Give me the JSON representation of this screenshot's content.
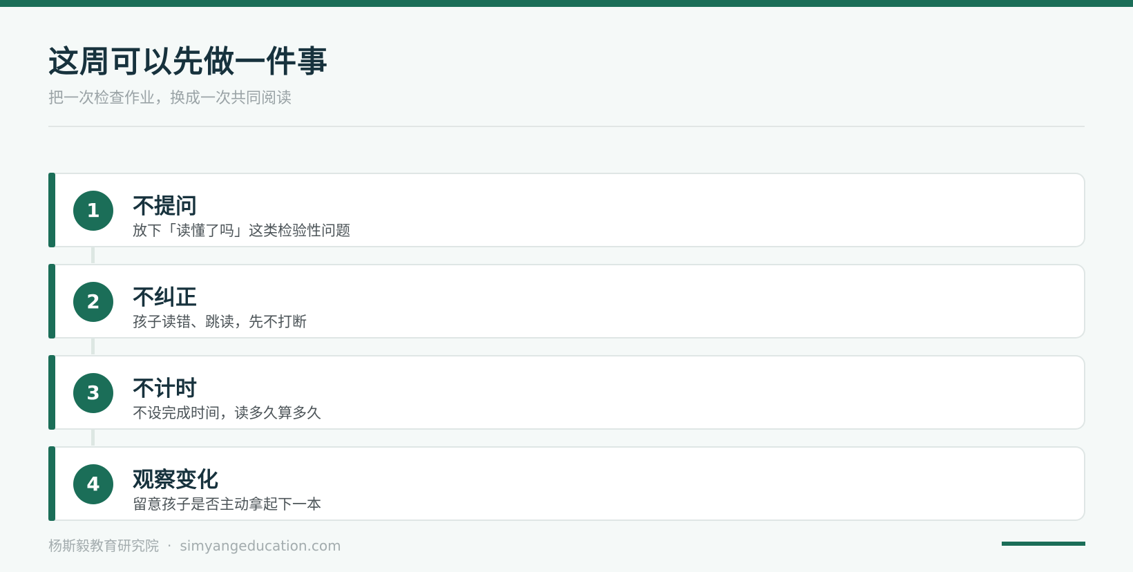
{
  "header": {
    "title": "这周可以先做一件事",
    "subtitle": "把一次检查作业，换成一次共同阅读"
  },
  "steps": [
    {
      "number": "1",
      "title": "不提问",
      "desc": "放下「读懂了吗」这类检验性问题"
    },
    {
      "number": "2",
      "title": "不纠正",
      "desc": "孩子读错、跳读，先不打断"
    },
    {
      "number": "3",
      "title": "不计时",
      "desc": "不设完成时间，读多久算多久"
    },
    {
      "number": "4",
      "title": "观察变化",
      "desc": "留意孩子是否主动拿起下一本"
    }
  ],
  "footer": {
    "org": "杨斯毅教育研究院",
    "separator": "·",
    "site": "simyangeducation.com"
  },
  "colors": {
    "accent": "#1b6e58",
    "title": "#17323d",
    "background": "#f5f9f8"
  }
}
